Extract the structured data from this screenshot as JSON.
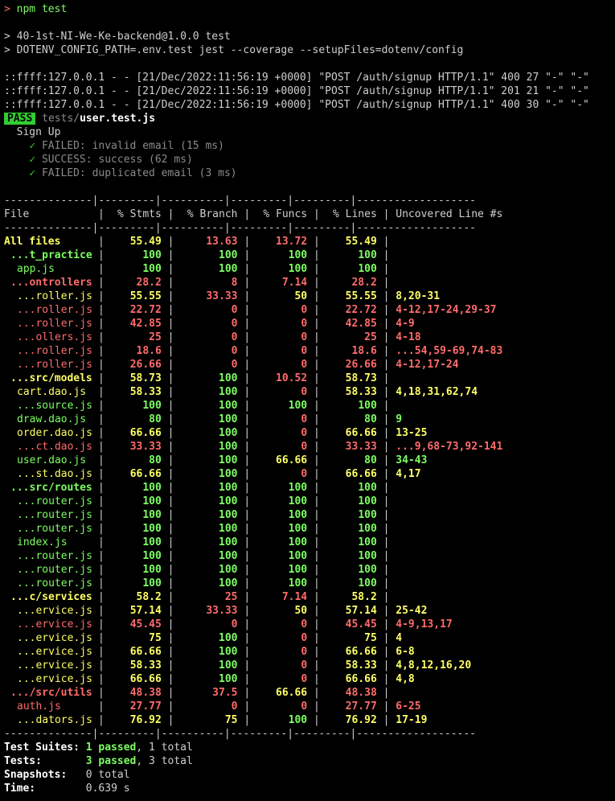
{
  "prompt": {
    "symbol": ">",
    "command": "npm test"
  },
  "script_lines": [
    "> 40-1st-NI-We-Ke-backend@1.0.0 test",
    "> DOTENV_CONFIG_PATH=.env.test jest --coverage --setupFiles=dotenv/config"
  ],
  "log_lines": [
    "::ffff:127.0.0.1 - - [21/Dec/2022:11:56:19 +0000] \"POST /auth/signup HTTP/1.1\" 400 27 \"-\" \"-\"",
    "::ffff:127.0.0.1 - - [21/Dec/2022:11:56:19 +0000] \"POST /auth/signup HTTP/1.1\" 201 21 \"-\" \"-\"",
    "::ffff:127.0.0.1 - - [21/Dec/2022:11:56:19 +0000] \"POST /auth/signup HTTP/1.1\" 400 30 \"-\" \"-\""
  ],
  "result": {
    "badge": "PASS",
    "path_dir": "tests/",
    "path_file": "user.test.js"
  },
  "suite": {
    "name": "Sign Up",
    "tests": [
      {
        "mark": "✓",
        "text": "FAILED: invalid email (15 ms)"
      },
      {
        "mark": "✓",
        "text": "SUCCESS: success (62 ms)"
      },
      {
        "mark": "✓",
        "text": "FAILED: duplicated email (3 ms)"
      }
    ]
  },
  "table": {
    "divider": "--------------|---------|----------|---------|---------|-------------------",
    "header": {
      "file": "File",
      "stmts": "% Stmts",
      "branch": "% Branch",
      "funcs": "% Funcs",
      "lines": "% Lines",
      "uncovered": "Uncovered Line #s"
    },
    "rows": [
      {
        "name": "All files",
        "stmts": "55.49",
        "branch": "13.63",
        "funcs": "13.72",
        "lines": "55.49",
        "uncovered": "",
        "sc": "yellow",
        "bc": "red",
        "fc": "red",
        "lc": "yellow",
        "bold": true,
        "indent": 0
      },
      {
        "name": "...t_practice",
        "stmts": "100",
        "branch": "100",
        "funcs": "100",
        "lines": "100",
        "uncovered": "",
        "sc": "green",
        "bc": "green",
        "fc": "green",
        "lc": "green",
        "bold": true,
        "indent": 1
      },
      {
        "name": "app.js",
        "stmts": "100",
        "branch": "100",
        "funcs": "100",
        "lines": "100",
        "uncovered": "",
        "sc": "green",
        "bc": "green",
        "fc": "green",
        "lc": "green",
        "bold": false,
        "indent": 2
      },
      {
        "name": "...ontrollers",
        "stmts": "28.2",
        "branch": "8",
        "funcs": "7.14",
        "lines": "28.2",
        "uncovered": "",
        "sc": "red",
        "bc": "red",
        "fc": "red",
        "lc": "red",
        "bold": true,
        "indent": 1
      },
      {
        "name": "...roller.js",
        "stmts": "55.55",
        "branch": "33.33",
        "funcs": "50",
        "lines": "55.55",
        "uncovered": "8,20-31",
        "sc": "yellow",
        "bc": "red",
        "fc": "yellow",
        "lc": "yellow",
        "bold": false,
        "indent": 2
      },
      {
        "name": "...roller.js",
        "stmts": "22.72",
        "branch": "0",
        "funcs": "0",
        "lines": "22.72",
        "uncovered": "4-12,17-24,29-37",
        "sc": "red",
        "bc": "red",
        "fc": "red",
        "lc": "red",
        "bold": false,
        "indent": 2
      },
      {
        "name": "...roller.js",
        "stmts": "42.85",
        "branch": "0",
        "funcs": "0",
        "lines": "42.85",
        "uncovered": "4-9",
        "sc": "red",
        "bc": "red",
        "fc": "red",
        "lc": "red",
        "bold": false,
        "indent": 2
      },
      {
        "name": "...ollers.js",
        "stmts": "25",
        "branch": "0",
        "funcs": "0",
        "lines": "25",
        "uncovered": "4-18",
        "sc": "red",
        "bc": "red",
        "fc": "red",
        "lc": "red",
        "bold": false,
        "indent": 2
      },
      {
        "name": "...roller.js",
        "stmts": "18.6",
        "branch": "0",
        "funcs": "0",
        "lines": "18.6",
        "uncovered": "...54,59-69,74-83",
        "sc": "red",
        "bc": "red",
        "fc": "red",
        "lc": "red",
        "bold": false,
        "indent": 2
      },
      {
        "name": "...roller.js",
        "stmts": "26.66",
        "branch": "0",
        "funcs": "0",
        "lines": "26.66",
        "uncovered": "4-12,17-24",
        "sc": "red",
        "bc": "red",
        "fc": "red",
        "lc": "red",
        "bold": false,
        "indent": 2
      },
      {
        "name": "...src/models",
        "stmts": "58.73",
        "branch": "100",
        "funcs": "10.52",
        "lines": "58.73",
        "uncovered": "",
        "sc": "yellow",
        "bc": "green",
        "fc": "red",
        "lc": "yellow",
        "bold": true,
        "indent": 1
      },
      {
        "name": "cart.dao.js",
        "stmts": "58.33",
        "branch": "100",
        "funcs": "0",
        "lines": "58.33",
        "uncovered": "4,18,31,62,74",
        "sc": "yellow",
        "bc": "green",
        "fc": "red",
        "lc": "yellow",
        "bold": false,
        "indent": 2
      },
      {
        "name": "...source.js",
        "stmts": "100",
        "branch": "100",
        "funcs": "100",
        "lines": "100",
        "uncovered": "",
        "sc": "green",
        "bc": "green",
        "fc": "green",
        "lc": "green",
        "bold": false,
        "indent": 2
      },
      {
        "name": "draw.dao.js",
        "stmts": "80",
        "branch": "100",
        "funcs": "0",
        "lines": "80",
        "uncovered": "9",
        "sc": "green",
        "bc": "green",
        "fc": "red",
        "lc": "green",
        "bold": false,
        "indent": 2
      },
      {
        "name": "order.dao.js",
        "stmts": "66.66",
        "branch": "100",
        "funcs": "0",
        "lines": "66.66",
        "uncovered": "13-25",
        "sc": "yellow",
        "bc": "green",
        "fc": "red",
        "lc": "yellow",
        "bold": false,
        "indent": 2
      },
      {
        "name": "...ct.dao.js",
        "stmts": "33.33",
        "branch": "100",
        "funcs": "0",
        "lines": "33.33",
        "uncovered": "...9,68-73,92-141",
        "sc": "red",
        "bc": "green",
        "fc": "red",
        "lc": "red",
        "bold": false,
        "indent": 2
      },
      {
        "name": "user.dao.js",
        "stmts": "80",
        "branch": "100",
        "funcs": "66.66",
        "lines": "80",
        "uncovered": "34-43",
        "sc": "green",
        "bc": "green",
        "fc": "yellow",
        "lc": "green",
        "bold": false,
        "indent": 2
      },
      {
        "name": "...st.dao.js",
        "stmts": "66.66",
        "branch": "100",
        "funcs": "0",
        "lines": "66.66",
        "uncovered": "4,17",
        "sc": "yellow",
        "bc": "green",
        "fc": "red",
        "lc": "yellow",
        "bold": false,
        "indent": 2
      },
      {
        "name": "...src/routes",
        "stmts": "100",
        "branch": "100",
        "funcs": "100",
        "lines": "100",
        "uncovered": "",
        "sc": "green",
        "bc": "green",
        "fc": "green",
        "lc": "green",
        "bold": true,
        "indent": 1
      },
      {
        "name": "...router.js",
        "stmts": "100",
        "branch": "100",
        "funcs": "100",
        "lines": "100",
        "uncovered": "",
        "sc": "green",
        "bc": "green",
        "fc": "green",
        "lc": "green",
        "bold": false,
        "indent": 2
      },
      {
        "name": "...router.js",
        "stmts": "100",
        "branch": "100",
        "funcs": "100",
        "lines": "100",
        "uncovered": "",
        "sc": "green",
        "bc": "green",
        "fc": "green",
        "lc": "green",
        "bold": false,
        "indent": 2
      },
      {
        "name": "...router.js",
        "stmts": "100",
        "branch": "100",
        "funcs": "100",
        "lines": "100",
        "uncovered": "",
        "sc": "green",
        "bc": "green",
        "fc": "green",
        "lc": "green",
        "bold": false,
        "indent": 2
      },
      {
        "name": "index.js",
        "stmts": "100",
        "branch": "100",
        "funcs": "100",
        "lines": "100",
        "uncovered": "",
        "sc": "green",
        "bc": "green",
        "fc": "green",
        "lc": "green",
        "bold": false,
        "indent": 2
      },
      {
        "name": "...router.js",
        "stmts": "100",
        "branch": "100",
        "funcs": "100",
        "lines": "100",
        "uncovered": "",
        "sc": "green",
        "bc": "green",
        "fc": "green",
        "lc": "green",
        "bold": false,
        "indent": 2
      },
      {
        "name": "...router.js",
        "stmts": "100",
        "branch": "100",
        "funcs": "100",
        "lines": "100",
        "uncovered": "",
        "sc": "green",
        "bc": "green",
        "fc": "green",
        "lc": "green",
        "bold": false,
        "indent": 2
      },
      {
        "name": "...router.js",
        "stmts": "100",
        "branch": "100",
        "funcs": "100",
        "lines": "100",
        "uncovered": "",
        "sc": "green",
        "bc": "green",
        "fc": "green",
        "lc": "green",
        "bold": false,
        "indent": 2
      },
      {
        "name": "...c/services",
        "stmts": "58.2",
        "branch": "25",
        "funcs": "7.14",
        "lines": "58.2",
        "uncovered": "",
        "sc": "yellow",
        "bc": "red",
        "fc": "red",
        "lc": "yellow",
        "bold": true,
        "indent": 1
      },
      {
        "name": "...ervice.js",
        "stmts": "57.14",
        "branch": "33.33",
        "funcs": "50",
        "lines": "57.14",
        "uncovered": "25-42",
        "sc": "yellow",
        "bc": "red",
        "fc": "yellow",
        "lc": "yellow",
        "bold": false,
        "indent": 2
      },
      {
        "name": "...ervice.js",
        "stmts": "45.45",
        "branch": "0",
        "funcs": "0",
        "lines": "45.45",
        "uncovered": "4-9,13,17",
        "sc": "red",
        "bc": "red",
        "fc": "red",
        "lc": "red",
        "bold": false,
        "indent": 2
      },
      {
        "name": "...ervice.js",
        "stmts": "75",
        "branch": "100",
        "funcs": "0",
        "lines": "75",
        "uncovered": "4",
        "sc": "yellow",
        "bc": "green",
        "fc": "red",
        "lc": "yellow",
        "bold": false,
        "indent": 2
      },
      {
        "name": "...ervice.js",
        "stmts": "66.66",
        "branch": "100",
        "funcs": "0",
        "lines": "66.66",
        "uncovered": "6-8",
        "sc": "yellow",
        "bc": "green",
        "fc": "red",
        "lc": "yellow",
        "bold": false,
        "indent": 2
      },
      {
        "name": "...ervice.js",
        "stmts": "58.33",
        "branch": "100",
        "funcs": "0",
        "lines": "58.33",
        "uncovered": "4,8,12,16,20",
        "sc": "yellow",
        "bc": "green",
        "fc": "red",
        "lc": "yellow",
        "bold": false,
        "indent": 2
      },
      {
        "name": "...ervice.js",
        "stmts": "66.66",
        "branch": "100",
        "funcs": "0",
        "lines": "66.66",
        "uncovered": "4,8",
        "sc": "yellow",
        "bc": "green",
        "fc": "red",
        "lc": "yellow",
        "bold": false,
        "indent": 2
      },
      {
        "name": ".../src/utils",
        "stmts": "48.38",
        "branch": "37.5",
        "funcs": "66.66",
        "lines": "48.38",
        "uncovered": "",
        "sc": "red",
        "bc": "red",
        "fc": "yellow",
        "lc": "red",
        "bold": true,
        "indent": 1
      },
      {
        "name": "auth.js",
        "stmts": "27.77",
        "branch": "0",
        "funcs": "0",
        "lines": "27.77",
        "uncovered": "6-25",
        "sc": "red",
        "bc": "red",
        "fc": "red",
        "lc": "red",
        "bold": false,
        "indent": 2
      },
      {
        "name": "...dators.js",
        "stmts": "76.92",
        "branch": "75",
        "funcs": "100",
        "lines": "76.92",
        "uncovered": "17-19",
        "sc": "yellow",
        "bc": "yellow",
        "fc": "green",
        "lc": "yellow",
        "bold": false,
        "indent": 2
      }
    ]
  },
  "summary": {
    "suites": {
      "label": "Test Suites:",
      "passed": "1 passed",
      "rest": ", 1 total"
    },
    "tests": {
      "label": "Tests:",
      "passed": "3 passed",
      "rest": ", 3 total"
    },
    "snapshots": {
      "label": "Snapshots:",
      "value": "0 total"
    },
    "time": {
      "label": "Time:",
      "value": "0.639 s"
    }
  },
  "colors": {
    "background": "#000000",
    "text": "#cfcfcf",
    "red": "#ff6b6b",
    "green": "#7dff63",
    "yellow": "#ffff66",
    "pass_badge": "#33cc33"
  }
}
